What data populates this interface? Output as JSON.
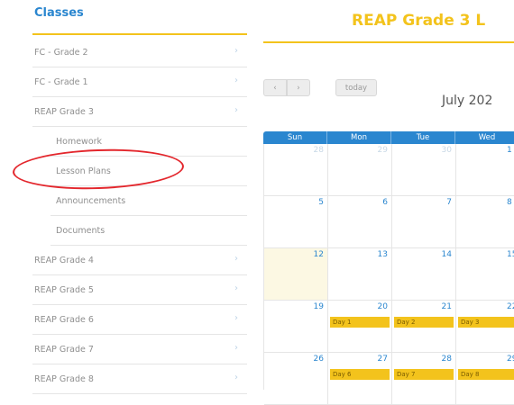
{
  "sidebar": {
    "title": "Classes",
    "items": [
      {
        "label": "FC - Grade 2",
        "chevron": "›"
      },
      {
        "label": "FC - Grade 1",
        "chevron": "›"
      },
      {
        "label": "REAP Grade 3",
        "chevron": "›"
      },
      {
        "label": "REAP Grade 4",
        "chevron": "›"
      },
      {
        "label": "REAP Grade 5",
        "chevron": "›"
      },
      {
        "label": "REAP Grade 6",
        "chevron": "›"
      },
      {
        "label": "REAP Grade 7",
        "chevron": "›"
      },
      {
        "label": "REAP Grade 8",
        "chevron": "›"
      }
    ],
    "subitems": [
      {
        "label": "Homework"
      },
      {
        "label": "Lesson Plans"
      },
      {
        "label": "Announcements"
      },
      {
        "label": "Documents"
      }
    ]
  },
  "main": {
    "title": "REAP Grade 3 L",
    "toolbar": {
      "prev": "‹",
      "next": "›",
      "today": "today"
    },
    "calendar_title": "July 202"
  },
  "calendar": {
    "days": [
      "Sun",
      "Mon",
      "Tue",
      "Wed"
    ],
    "weeks": [
      [
        {
          "n": "28",
          "other": true
        },
        {
          "n": "29",
          "other": true
        },
        {
          "n": "30",
          "other": true
        },
        {
          "n": "1"
        }
      ],
      [
        {
          "n": "5"
        },
        {
          "n": "6"
        },
        {
          "n": "7"
        },
        {
          "n": "8"
        }
      ],
      [
        {
          "n": "12",
          "today": true
        },
        {
          "n": "13"
        },
        {
          "n": "14"
        },
        {
          "n": "15"
        }
      ],
      [
        {
          "n": "19"
        },
        {
          "n": "20",
          "event": "Day 1"
        },
        {
          "n": "21",
          "event": "Day 2"
        },
        {
          "n": "22",
          "event": "Day 3"
        }
      ],
      [
        {
          "n": "26"
        },
        {
          "n": "27",
          "event": "Day 6"
        },
        {
          "n": "28",
          "event": "Day 7"
        },
        {
          "n": "29",
          "event": "Day 8"
        }
      ]
    ]
  },
  "colors": {
    "accent": "#2a86cf",
    "highlight": "#f3c31c",
    "annotation": "#e3262c"
  }
}
